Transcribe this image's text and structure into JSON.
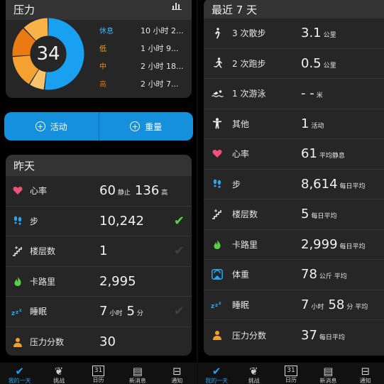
{
  "left": {
    "stress": {
      "title": "压力",
      "score": "34",
      "legend": [
        {
          "key": "休息",
          "value": "10 小时 2...",
          "color": "#43b3f5"
        },
        {
          "key": "低",
          "value": "1 小时 9...",
          "color": "#f7a628"
        },
        {
          "key": "中",
          "value": "2 小时 18...",
          "color": "#f28b1b"
        },
        {
          "key": "高",
          "value": "2 小时 7...",
          "color": "#e56a0c"
        }
      ],
      "donut": [
        {
          "fraction": 0.52,
          "color": "#1aa0f0"
        },
        {
          "fraction": 0.07,
          "color": "#f8c36a"
        },
        {
          "fraction": 0.15,
          "color": "#f4a132"
        },
        {
          "fraction": 0.14,
          "color": "#ea7b12"
        },
        {
          "fraction": 0.12,
          "color": "#f7b24a"
        }
      ]
    },
    "actions": {
      "activity": "活动",
      "weight": "重量"
    },
    "yesterday": {
      "title": "昨天",
      "rows": [
        {
          "icon": "heart-icon",
          "label": "心率",
          "value": "60",
          "unit": "静止",
          "value2": "136",
          "unit2": "高",
          "check": ""
        },
        {
          "icon": "steps-icon",
          "label": "步",
          "value": "10,242",
          "unit": "",
          "check": "done"
        },
        {
          "icon": "stairs-icon",
          "label": "楼层数",
          "value": "1",
          "unit": "",
          "check": "pending"
        },
        {
          "icon": "flame-icon",
          "label": "卡路里",
          "value": "2,995",
          "unit": "",
          "check": ""
        },
        {
          "icon": "sleep-icon",
          "label": "睡眠",
          "value": "7",
          "unit": "小时",
          "value2": "5",
          "unit2": "分",
          "check": "pending"
        },
        {
          "icon": "stress-person-icon",
          "label": "压力分数",
          "value": "30",
          "unit": "",
          "check": ""
        }
      ]
    },
    "nav": [
      {
        "label": "我的一天",
        "icon": "✔",
        "active": true
      },
      {
        "label": "挑战",
        "icon": "❦",
        "active": false
      },
      {
        "label": "日历",
        "icon": "31",
        "active": false
      },
      {
        "label": "新消息",
        "icon": "▤",
        "active": false
      },
      {
        "label": "通知",
        "icon": "⊟",
        "active": false
      }
    ]
  },
  "right": {
    "week": {
      "title": "最近 7 天",
      "rows": [
        {
          "icon": "walk-icon",
          "label": "3 次散步",
          "value": "3.1",
          "unit": "公里"
        },
        {
          "icon": "run-icon",
          "label": "2 次跑步",
          "value": "0.5",
          "unit": "公里"
        },
        {
          "icon": "swim-icon",
          "label": "1 次游泳",
          "value": "- -",
          "unit": "米"
        },
        {
          "icon": "other-icon",
          "label": "其他",
          "value": "1",
          "unit": "活动"
        },
        {
          "icon": "heart-icon",
          "label": "心率",
          "value": "61",
          "unit": "平均静息"
        },
        {
          "icon": "steps-icon",
          "label": "步",
          "value": "8,614",
          "unit": "每日平均"
        },
        {
          "icon": "stairs-icon",
          "label": "楼层数",
          "value": "5",
          "unit": "每日平均"
        },
        {
          "icon": "flame-icon",
          "label": "卡路里",
          "value": "2,999",
          "unit": "每日平均"
        },
        {
          "icon": "scale-icon",
          "label": "体重",
          "value": "78",
          "unit": "公斤 平均"
        },
        {
          "icon": "sleep-icon",
          "label": "睡眠",
          "value": "7",
          "unit": "小时",
          "value2": "58",
          "unit2": "分 平均"
        },
        {
          "icon": "stress-person-icon",
          "label": "压力分数",
          "value": "37",
          "unit": "每日平均"
        }
      ]
    },
    "nav": [
      {
        "label": "我的一天",
        "icon": "✔",
        "active": true
      },
      {
        "label": "挑战",
        "icon": "❦",
        "active": false
      },
      {
        "label": "日历",
        "icon": "31",
        "active": false
      },
      {
        "label": "新消息",
        "icon": "▤",
        "active": false
      },
      {
        "label": "通知",
        "icon": "⊟",
        "active": false
      }
    ]
  }
}
